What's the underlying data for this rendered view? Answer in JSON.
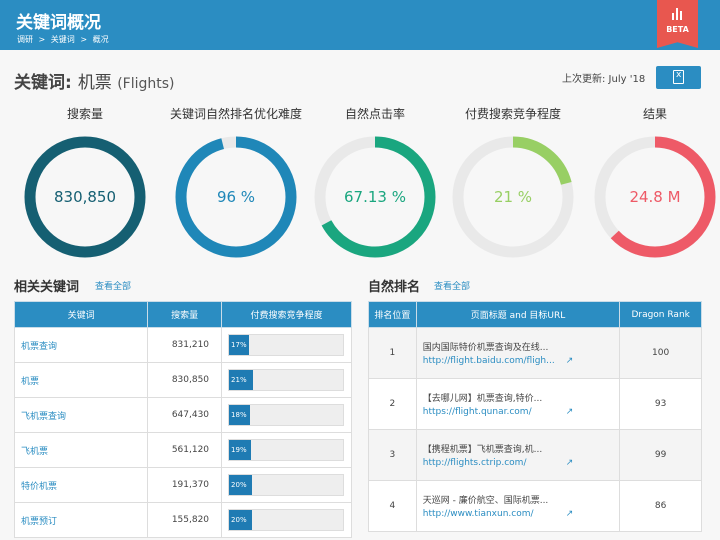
{
  "header": {
    "title": "关键词概况",
    "breadcrumb": [
      "调研",
      ">",
      "关键词",
      ">",
      "概况"
    ],
    "beta_label": "BETA"
  },
  "keyword": {
    "prefix": "关键词:",
    "term": "机票",
    "english": "(Flights)"
  },
  "last_updated": "上次更新: July '18",
  "export_icon": "excel-export-icon",
  "metrics": [
    {
      "label": "搜索量",
      "value": "830,850",
      "fraction": 1.0,
      "color": "#155f72"
    },
    {
      "label": "关键词自然排名优化难度",
      "value": "96 %",
      "fraction": 0.96,
      "color": "#1f87b8"
    },
    {
      "label": "自然点击率",
      "value": "67.13 %",
      "fraction": 0.6713,
      "color": "#1aa67f"
    },
    {
      "label": "付费搜索竞争程度",
      "value": "21 %",
      "fraction": 0.21,
      "color": "#98cf64"
    },
    {
      "label": "结果",
      "value": "24.8 M",
      "fraction": 0.63,
      "color": "#ee5a67"
    }
  ],
  "related": {
    "title": "相关关键词",
    "see_all": "查看全部",
    "columns": [
      "关键词",
      "搜索量",
      "付费搜索竞争程度"
    ],
    "rows": [
      {
        "keyword": "机票查询",
        "volume": "831,210",
        "competition": "17%",
        "comp_value": 0.17
      },
      {
        "keyword": "机票",
        "volume": "830,850",
        "competition": "21%",
        "comp_value": 0.21
      },
      {
        "keyword": "飞机票查询",
        "volume": "647,430",
        "competition": "18%",
        "comp_value": 0.18
      },
      {
        "keyword": "飞机票",
        "volume": "561,120",
        "competition": "19%",
        "comp_value": 0.19
      },
      {
        "keyword": "特价机票",
        "volume": "191,370",
        "competition": "20%",
        "comp_value": 0.2
      },
      {
        "keyword": "机票预订",
        "volume": "155,820",
        "competition": "20%",
        "comp_value": 0.2
      }
    ]
  },
  "organic": {
    "title": "自然排名",
    "see_all": "查看全部",
    "columns": [
      "排名位置",
      "页面标题 and 目标URL",
      "Dragon Rank"
    ],
    "rows": [
      {
        "position": "1",
        "page_title": "国内国际特价机票查询及在线...",
        "url": "http://flight.baidu.com/fligh...",
        "rank": "100"
      },
      {
        "position": "2",
        "page_title": "【去哪儿网】机票查询,特价...",
        "url": "https://flight.qunar.com/",
        "rank": "93"
      },
      {
        "position": "3",
        "page_title": "【携程机票】飞机票查询,机...",
        "url": "http://flights.ctrip.com/",
        "rank": "99"
      },
      {
        "position": "4",
        "page_title": "天巡网 - 廉价航空、国际机票...",
        "url": "http://www.tianxun.com/",
        "rank": "86"
      }
    ]
  }
}
